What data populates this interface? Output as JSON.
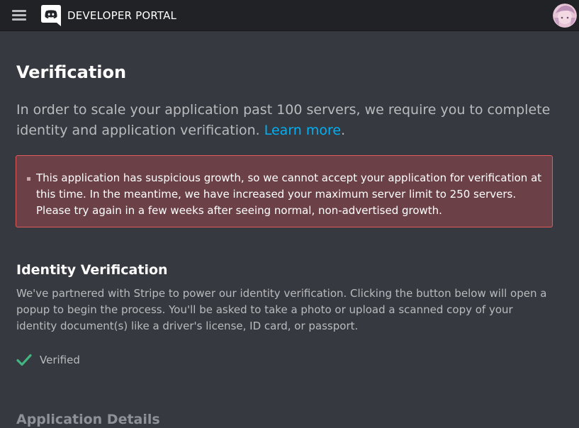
{
  "header": {
    "brand": "DEVELOPER PORTAL",
    "menu_icon": "hamburger-menu-icon",
    "logo_icon": "discord-logo-icon",
    "avatar": "user-avatar"
  },
  "page": {
    "title": "Verification",
    "intro_text": "In order to scale your application past 100 servers, we require you to complete identity and application verification.",
    "learn_more_label": "Learn more",
    "intro_suffix": "."
  },
  "alert": {
    "message": "This application has suspicious growth, so we cannot accept your application for verification at this time. In the meantime, we have increased your maximum server limit to 250 servers. Please try again in a few weeks after seeing normal, non-advertised growth.",
    "background_color": "#6b4046",
    "border_color": "#e2595c"
  },
  "identity_section": {
    "title": "Identity Verification",
    "description": "We've partnered with Stripe to power our identity verification. Clicking the button below will open a popup to begin the process. You'll be asked to take a photo or upload a scanned copy of your identity document(s) like a driver's license, ID card, or passport.",
    "status_label": "Verified",
    "status_icon": "checkmark-icon",
    "status_color": "#43b581"
  },
  "application_section": {
    "title": "Application Details"
  },
  "colors": {
    "background": "#36393f",
    "topbar": "#202225",
    "link": "#00b0f4",
    "muted_text": "#b9bbbe"
  }
}
